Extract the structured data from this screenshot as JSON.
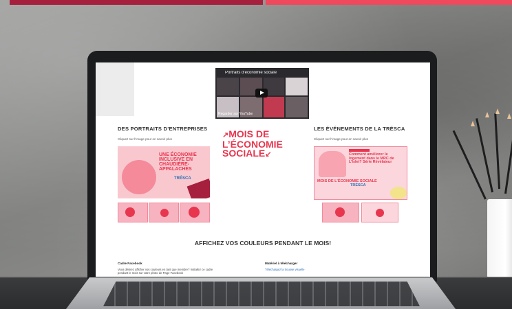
{
  "colors": {
    "top_bar_left": "#a61f3c",
    "top_bar_right": "#f0485c",
    "campaign_red": "#e8364f",
    "link_blue": "#2a6fb7"
  },
  "video": {
    "title": "Portraits d’économie sociale",
    "youtube_label": "Regarder sur YouTube"
  },
  "left_section": {
    "title": "DES PORTRAITS D’ENTREPRISES",
    "subtitle": "Cliquez sur l’image pour en savoir plus",
    "promo_headline": "UNE ÉCONOMIE INCLUSIVE EN CHAUDIÈRE-APPALACHES",
    "promo_logo": "TRÉSCA"
  },
  "campaign": {
    "line1": "MOIS DE",
    "line2": "L’ÉCONOMIE",
    "line3": "SOCIALE"
  },
  "right_section": {
    "title": "LES ÉVÉNEMENTS DE LA TRÉSCA",
    "subtitle": "Cliquez sur l’image pour en savoir plus",
    "promo_headline": "Comment améliorer le logement dans le MRC de L’Islet? Série Révélateur",
    "promo_mini": "MOIS DE L’ÉCONOMIE SOCIALE",
    "promo_logo": "TRÉSCA"
  },
  "bottom": {
    "heading": "AFFICHEZ VOS COULEURS PENDANT LE MOIS!",
    "cadre_title": "Cadre Facebook",
    "cadre_text": "Vous désirez afficher vos couleurs en tant que membre? Installez ce cadre pendant le mois sur votre photo de Page Facebook",
    "materiel_title": "Matériel à télécharger",
    "materiel_link": "Téléchargez la trousse visuelle"
  }
}
